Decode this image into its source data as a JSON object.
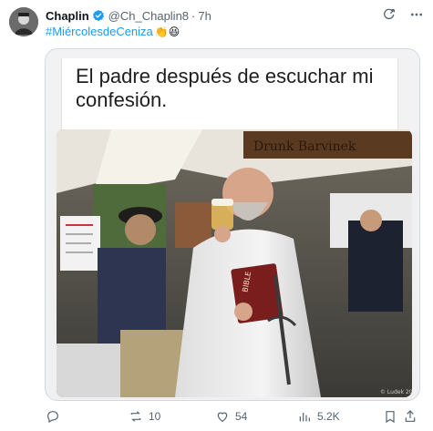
{
  "tweet": {
    "author": "Chaplin",
    "handle": "@Ch_Chaplin8",
    "separator": "·",
    "time": "7h",
    "hashtag": "#MiércolesdeCeniza",
    "emojis": "👏😆",
    "meme_caption": "El padre después de escuchar mi confesión.",
    "sign_text": "Drunk Barvinek",
    "verified_color": "#1d9bf0",
    "hashtag_color": "#1d9bf0"
  },
  "header_icons": [
    "grok-icon",
    "more-icon"
  ],
  "actions": {
    "reply": "",
    "retweets": "10",
    "likes": "54",
    "views": "5.2K"
  }
}
